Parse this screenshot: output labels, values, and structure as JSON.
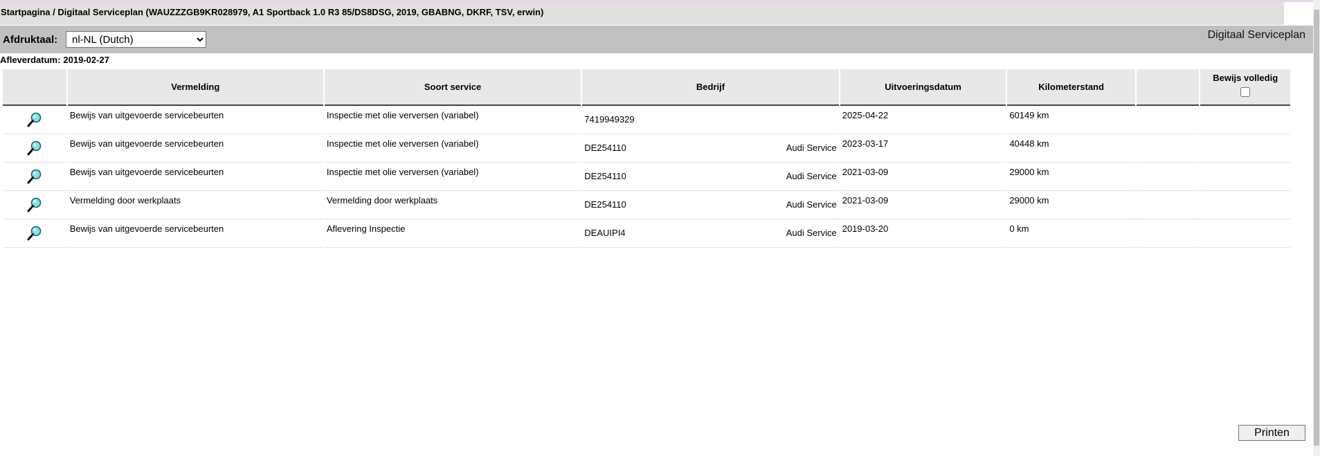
{
  "header": {
    "breadcrumb": "Startpagina / Digitaal Serviceplan (WAUZZZGB9KR028979, A1 Sportback 1.0 R3 85/DS8DSG, 2019, GBABNG, DKRF, TSV, erwin)"
  },
  "language": {
    "label": "Afdruktaal:",
    "selected": "nl-NL (Dutch)"
  },
  "app_title": "Digitaal Serviceplan",
  "delivery": {
    "label": "Afleverdatum:",
    "value": "2019-02-27"
  },
  "table": {
    "headers": {
      "vermelding": "Vermelding",
      "soort": "Soort service",
      "bedrijf": "Bedrijf",
      "datum": "Uitvoeringsdatum",
      "km": "Kilometerstand",
      "proof": "Bewijs volledig"
    },
    "rows": [
      {
        "vermelding": "Bewijs van uitgevoerde servicebeurten",
        "soort": "Inspectie met olie verversen (variabel)",
        "code": "7419949329",
        "bedrijf": "",
        "datum": "2025-04-22",
        "km": "60149 km"
      },
      {
        "vermelding": "Bewijs van uitgevoerde servicebeurten",
        "soort": "Inspectie met olie verversen (variabel)",
        "code": "DE254110",
        "bedrijf": "Audi Service",
        "datum": "2023-03-17",
        "km": "40448 km"
      },
      {
        "vermelding": "Bewijs van uitgevoerde servicebeurten",
        "soort": "Inspectie met olie verversen (variabel)",
        "code": "DE254110",
        "bedrijf": "Audi Service",
        "datum": "2021-03-09",
        "km": "29000 km"
      },
      {
        "vermelding": "Vermelding door werkplaats",
        "soort": "Vermelding door werkplaats",
        "code": "DE254110",
        "bedrijf": "Audi Service",
        "datum": "2021-03-09",
        "km": "29000 km"
      },
      {
        "vermelding": "Bewijs van uitgevoerde servicebeurten",
        "soort": "Aflevering Inspectie",
        "code": "DEAUIPI4",
        "bedrijf": "Audi Service",
        "datum": "2019-03-20",
        "km": "0 km"
      }
    ]
  },
  "actions": {
    "print_label": "Printen"
  },
  "icons": {
    "row_detail": "magnifier-icon",
    "select_chevron": "chevron-down-icon"
  },
  "colors": {
    "header_bar": "#e0e0e0",
    "lang_bar": "#c0c0c0",
    "table_header": "#e8e8e8"
  }
}
